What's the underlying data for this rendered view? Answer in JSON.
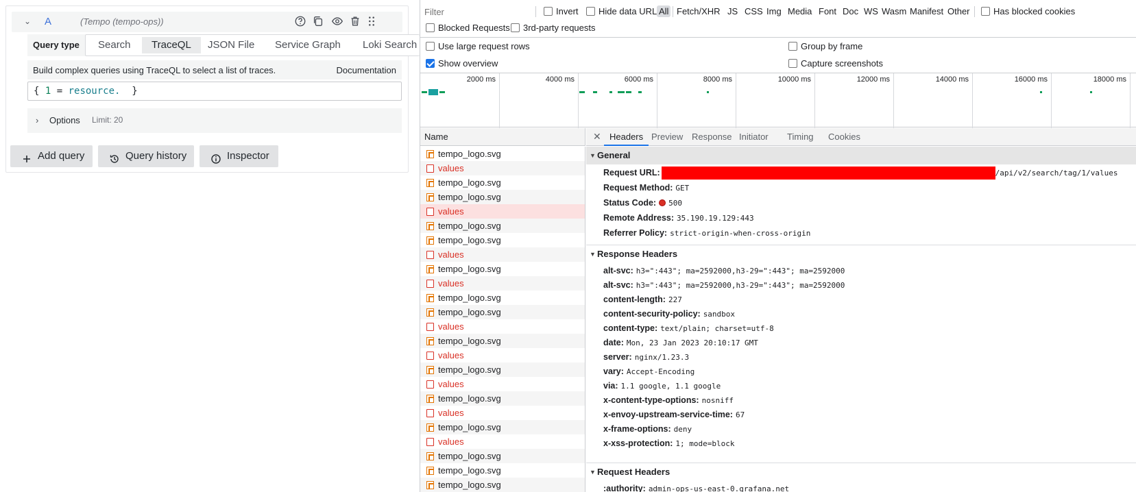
{
  "query_editor": {
    "ref_id": "A",
    "datasource": "(Tempo (tempo-ops))",
    "query_type_label": "Query type",
    "query_types": [
      "Search",
      "TraceQL",
      "JSON File",
      "Service Graph",
      "Loki Search"
    ],
    "active_query_type": "TraceQL",
    "builder_hint": "Build complex queries using TraceQL to select a list of traces.",
    "documentation_link": "Documentation",
    "query_tokens": {
      "open": "{ ",
      "num": "1",
      "op": " = ",
      "attr": "resource.",
      "close": "  }"
    },
    "options_label": "Options",
    "options_limit": "Limit: 20",
    "add_query_label": "Add query",
    "query_history_label": "Query history",
    "inspector_label": "Inspector"
  },
  "devtools": {
    "filter_placeholder": "Filter",
    "invert_label": "Invert",
    "hide_data_urls_label": "Hide data URLs",
    "type_filters": [
      "All",
      "Fetch/XHR",
      "JS",
      "CSS",
      "Img",
      "Media",
      "Font",
      "Doc",
      "WS",
      "Wasm",
      "Manifest",
      "Other"
    ],
    "active_type_filter": "All",
    "has_blocked_cookies_label": "Has blocked cookies",
    "blocked_requests_label": "Blocked Requests",
    "third_party_label": "3rd-party requests",
    "large_rows_label": "Use large request rows",
    "group_by_frame_label": "Group by frame",
    "show_overview_label": "Show overview",
    "show_overview_checked": true,
    "capture_screenshots_label": "Capture screenshots",
    "overview_ticks": [
      "2000 ms",
      "4000 ms",
      "6000 ms",
      "8000 ms",
      "10000 ms",
      "12000 ms",
      "14000 ms",
      "16000 ms",
      "18000 ms"
    ],
    "name_column": "Name",
    "requests": [
      {
        "name": "tempo_logo.svg",
        "type": "svg"
      },
      {
        "name": "values",
        "type": "error"
      },
      {
        "name": "tempo_logo.svg",
        "type": "svg"
      },
      {
        "name": "tempo_logo.svg",
        "type": "svg"
      },
      {
        "name": "values",
        "type": "error",
        "selected": true
      },
      {
        "name": "tempo_logo.svg",
        "type": "svg"
      },
      {
        "name": "tempo_logo.svg",
        "type": "svg"
      },
      {
        "name": "values",
        "type": "error"
      },
      {
        "name": "tempo_logo.svg",
        "type": "svg"
      },
      {
        "name": "values",
        "type": "error"
      },
      {
        "name": "tempo_logo.svg",
        "type": "svg"
      },
      {
        "name": "tempo_logo.svg",
        "type": "svg"
      },
      {
        "name": "values",
        "type": "error"
      },
      {
        "name": "tempo_logo.svg",
        "type": "svg"
      },
      {
        "name": "values",
        "type": "error"
      },
      {
        "name": "tempo_logo.svg",
        "type": "svg"
      },
      {
        "name": "values",
        "type": "error"
      },
      {
        "name": "tempo_logo.svg",
        "type": "svg"
      },
      {
        "name": "values",
        "type": "error"
      },
      {
        "name": "tempo_logo.svg",
        "type": "svg"
      },
      {
        "name": "values",
        "type": "error"
      },
      {
        "name": "tempo_logo.svg",
        "type": "svg"
      },
      {
        "name": "tempo_logo.svg",
        "type": "svg"
      },
      {
        "name": "tempo_logo.svg",
        "type": "svg"
      }
    ],
    "detail_tabs": [
      "Headers",
      "Preview",
      "Response",
      "Initiator",
      "Timing",
      "Cookies"
    ],
    "active_detail_tab": "Headers",
    "general": {
      "title": "General",
      "request_url_key": "Request URL:",
      "request_url_suffix": "/api/v2/search/tag/1/values",
      "request_method_key": "Request Method:",
      "request_method": "GET",
      "status_code_key": "Status Code:",
      "status_code": "500",
      "remote_address_key": "Remote Address:",
      "remote_address": "35.190.19.129:443",
      "referrer_policy_key": "Referrer Policy:",
      "referrer_policy": "strict-origin-when-cross-origin"
    },
    "response_headers_title": "Response Headers",
    "response_headers": [
      {
        "k": "alt-svc:",
        "v": "h3=\":443\"; ma=2592000,h3-29=\":443\"; ma=2592000"
      },
      {
        "k": "alt-svc:",
        "v": "h3=\":443\"; ma=2592000,h3-29=\":443\"; ma=2592000"
      },
      {
        "k": "content-length:",
        "v": "227"
      },
      {
        "k": "content-security-policy:",
        "v": "sandbox"
      },
      {
        "k": "content-type:",
        "v": "text/plain; charset=utf-8"
      },
      {
        "k": "date:",
        "v": "Mon, 23 Jan 2023 20:10:17 GMT"
      },
      {
        "k": "server:",
        "v": "nginx/1.23.3"
      },
      {
        "k": "vary:",
        "v": "Accept-Encoding"
      },
      {
        "k": "via:",
        "v": "1.1 google, 1.1 google"
      },
      {
        "k": "x-content-type-options:",
        "v": "nosniff"
      },
      {
        "k": "x-envoy-upstream-service-time:",
        "v": "67"
      },
      {
        "k": "x-frame-options:",
        "v": "deny"
      },
      {
        "k": "x-xss-protection:",
        "v": "1; mode=block"
      }
    ],
    "request_headers_title": "Request Headers",
    "request_headers": [
      {
        "k": ":authority:",
        "v": "admin-ops-us-east-0.grafana.net"
      }
    ],
    "colors": {
      "selection_blue": "#1a73e8",
      "error_red": "#d93025",
      "redaction": "#ff0000",
      "overview_green": "#0f9d58"
    }
  }
}
